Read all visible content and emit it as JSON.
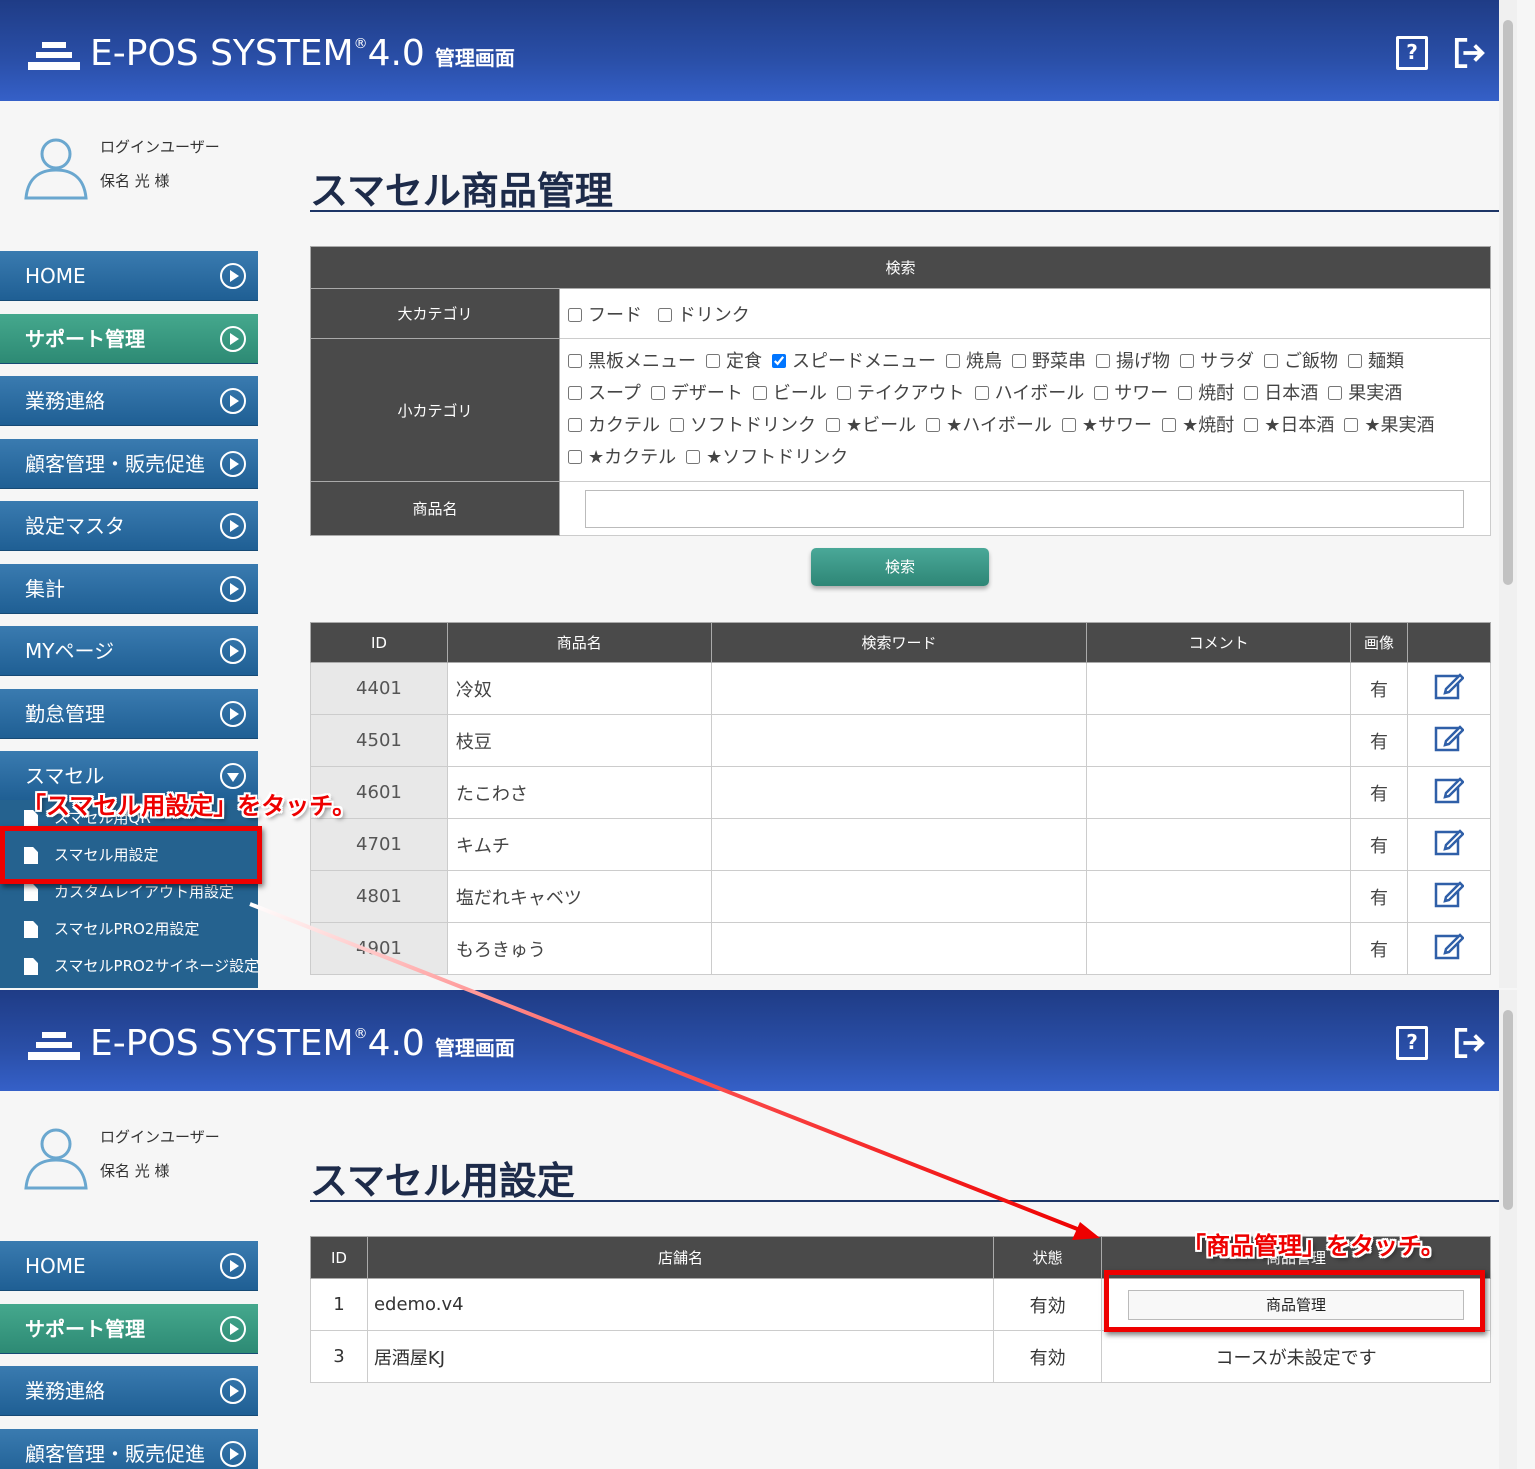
{
  "header": {
    "logo_text": "E-POS SYSTEM",
    "logo_reg": "®",
    "logo_version": "4.0",
    "logo_sub": "管理画面",
    "help_icon": "?"
  },
  "user": {
    "label": "ログインユーザー",
    "name": "保名 光 様"
  },
  "sidebar": {
    "items": [
      {
        "label": "HOME"
      },
      {
        "label": "サポート管理"
      },
      {
        "label": "業務連絡"
      },
      {
        "label": "顧客管理・販売促進"
      },
      {
        "label": "設定マスタ"
      },
      {
        "label": "集計"
      },
      {
        "label": "MYページ"
      },
      {
        "label": "勤怠管理"
      },
      {
        "label": "スマセル"
      }
    ],
    "sub_items": [
      {
        "label": "スマセル用QR"
      },
      {
        "label": "スマセル用設定"
      },
      {
        "label": "カスタムレイアウト用設定"
      },
      {
        "label": "スマセルPRO2用設定"
      },
      {
        "label": "スマセルPRO2サイネージ設定"
      }
    ]
  },
  "page1": {
    "title": "スマセル商品管理",
    "search": {
      "header": "検索",
      "large_category_label": "大カテゴリ",
      "large_categories": [
        {
          "label": "フード",
          "checked": false
        },
        {
          "label": "ドリンク",
          "checked": false
        }
      ],
      "small_category_label": "小カテゴリ",
      "small_categories": [
        {
          "label": "黒板メニュー",
          "checked": false
        },
        {
          "label": "定食",
          "checked": false
        },
        {
          "label": "スピードメニュー",
          "checked": true
        },
        {
          "label": "焼鳥",
          "checked": false
        },
        {
          "label": "野菜串",
          "checked": false
        },
        {
          "label": "揚げ物",
          "checked": false
        },
        {
          "label": "サラダ",
          "checked": false
        },
        {
          "label": "ご飯物",
          "checked": false
        },
        {
          "label": "麺類",
          "checked": false
        },
        {
          "label": "スープ",
          "checked": false
        },
        {
          "label": "デザート",
          "checked": false
        },
        {
          "label": "ビール",
          "checked": false
        },
        {
          "label": "テイクアウト",
          "checked": false
        },
        {
          "label": "ハイボール",
          "checked": false
        },
        {
          "label": "サワー",
          "checked": false
        },
        {
          "label": "焼酎",
          "checked": false
        },
        {
          "label": "日本酒",
          "checked": false
        },
        {
          "label": "果実酒",
          "checked": false
        },
        {
          "label": "カクテル",
          "checked": false
        },
        {
          "label": "ソフトドリンク",
          "checked": false
        },
        {
          "label": "★ビール",
          "checked": false
        },
        {
          "label": "★ハイボール",
          "checked": false
        },
        {
          "label": "★サワー",
          "checked": false
        },
        {
          "label": "★焼酎",
          "checked": false
        },
        {
          "label": "★日本酒",
          "checked": false
        },
        {
          "label": "★果実酒",
          "checked": false
        },
        {
          "label": "★カクテル",
          "checked": false
        },
        {
          "label": "★ソフトドリンク",
          "checked": false
        }
      ],
      "product_name_label": "商品名",
      "product_name_value": "",
      "search_button": "検索"
    },
    "results": {
      "columns": [
        "ID",
        "商品名",
        "検索ワード",
        "コメント",
        "画像",
        ""
      ],
      "rows": [
        {
          "id": "4401",
          "name": "冷奴",
          "keyword": "",
          "comment": "",
          "image": "有"
        },
        {
          "id": "4501",
          "name": "枝豆",
          "keyword": "",
          "comment": "",
          "image": "有"
        },
        {
          "id": "4601",
          "name": "たこわさ",
          "keyword": "",
          "comment": "",
          "image": "有"
        },
        {
          "id": "4701",
          "name": "キムチ",
          "keyword": "",
          "comment": "",
          "image": "有"
        },
        {
          "id": "4801",
          "name": "塩だれキャベツ",
          "keyword": "",
          "comment": "",
          "image": "有"
        },
        {
          "id": "4901",
          "name": "もろきゅう",
          "keyword": "",
          "comment": "",
          "image": "有"
        }
      ]
    }
  },
  "page2": {
    "title": "スマセル用設定",
    "columns": [
      "ID",
      "店舗名",
      "状態",
      "商品管理"
    ],
    "rows": [
      {
        "id": "1",
        "store": "edemo.v4",
        "status": "有効",
        "action": "商品管理",
        "is_button": true
      },
      {
        "id": "3",
        "store": "居酒屋KJ",
        "status": "有効",
        "action": "コースが未設定です",
        "is_button": false
      }
    ]
  },
  "annotations": {
    "left": "「スマセル用設定」をタッチ。",
    "right": "「商品管理」をタッチ。"
  },
  "colors": {
    "header": "#2a4fa8",
    "nav_blue": "#2a6ea4",
    "nav_green": "#3a9a80",
    "annotation": "#ee0000"
  }
}
